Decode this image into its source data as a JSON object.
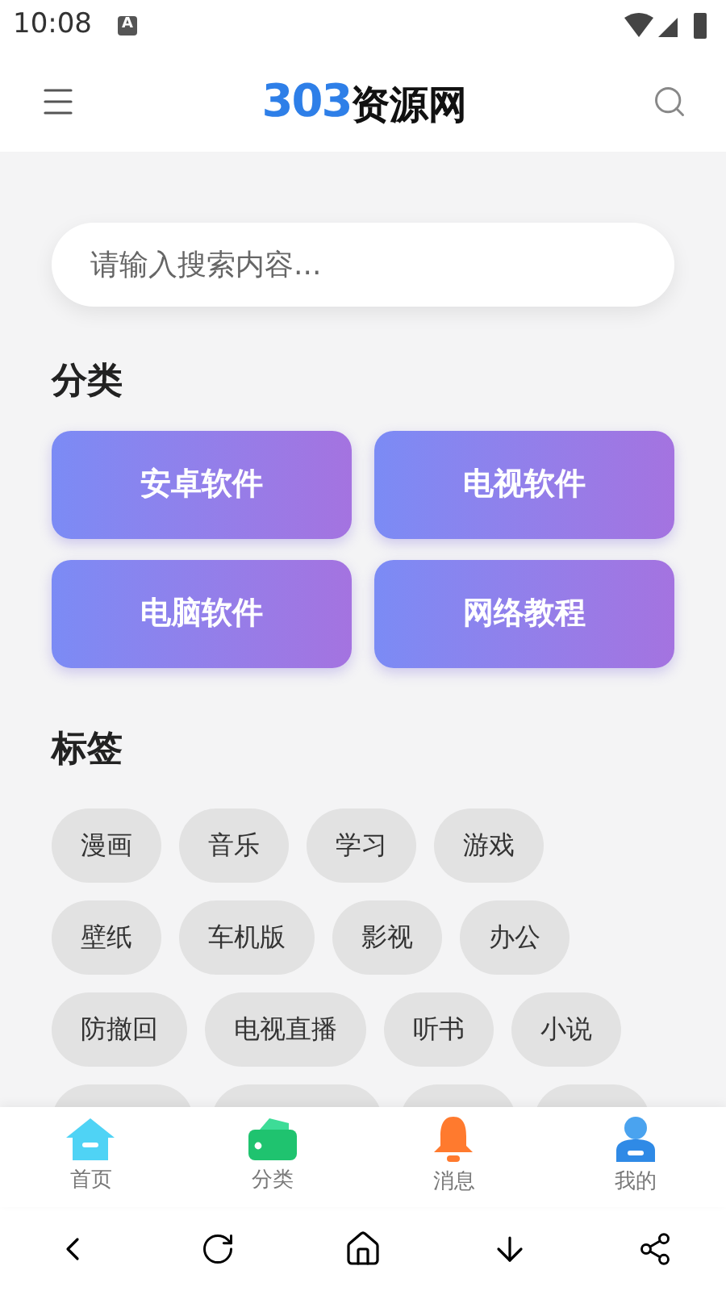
{
  "status_bar": {
    "time": "10:08",
    "notification_icon": "A"
  },
  "header": {
    "logo_number": "303",
    "logo_text": "资源网"
  },
  "search": {
    "placeholder": "请输入搜索内容..."
  },
  "categories": {
    "title": "分类",
    "items": [
      "安卓软件",
      "电视软件",
      "电脑软件",
      "网络教程"
    ]
  },
  "tags": {
    "title": "标签",
    "rows": [
      [
        "漫画",
        "音乐",
        "学习",
        "游戏"
      ],
      [
        "壁纸",
        "车机版",
        "影视",
        "办公"
      ],
      [
        "防撤回",
        "电视直播",
        "听书",
        "小说"
      ]
    ]
  },
  "bottom_nav": [
    {
      "label": "首页",
      "kind": "home"
    },
    {
      "label": "分类",
      "kind": "wallet"
    },
    {
      "label": "消息",
      "kind": "bell"
    },
    {
      "label": "我的",
      "kind": "user"
    }
  ]
}
